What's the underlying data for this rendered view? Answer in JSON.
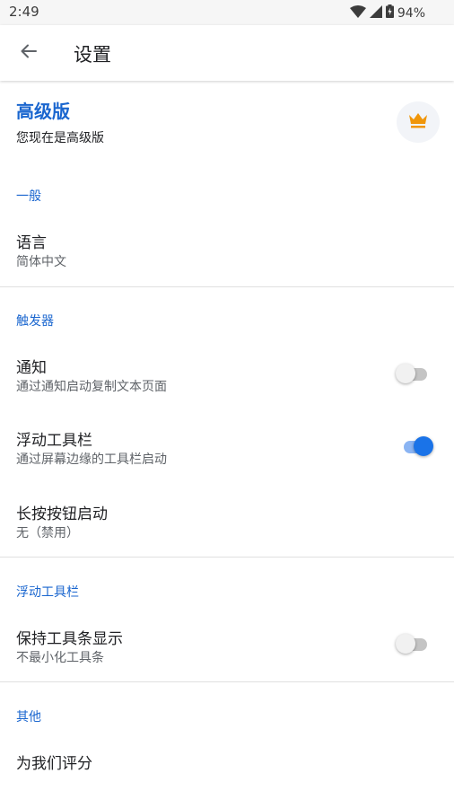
{
  "status_bar": {
    "time": "2:49",
    "battery": "94%",
    "icons": [
      "wifi-icon",
      "cell-signal-icon",
      "battery-icon"
    ]
  },
  "app_bar": {
    "title": "设置",
    "back_icon": "arrow-back-icon"
  },
  "premium": {
    "title": "高级版",
    "subtitle": "您现在是高级版",
    "icon": "crown-icon",
    "icon_color": "#f0960a"
  },
  "sections": {
    "general": {
      "header": "一般",
      "language": {
        "title": "语言",
        "subtitle": "简体中文"
      }
    },
    "triggers": {
      "header": "触发器",
      "notification": {
        "title": "通知",
        "subtitle": "通过通知启动复制文本页面",
        "enabled": false
      },
      "floating_toolbar": {
        "title": "浮动工具栏",
        "subtitle": "通过屏幕边缘的工具栏启动",
        "enabled": true
      },
      "long_press": {
        "title": "长按按钮启动",
        "subtitle": "无（禁用）"
      }
    },
    "floating": {
      "header": "浮动工具栏",
      "keep_visible": {
        "title": "保持工具条显示",
        "subtitle": "不最小化工具条",
        "enabled": false
      }
    },
    "other": {
      "header": "其他",
      "rate": {
        "title": "为我们评分"
      }
    }
  },
  "colors": {
    "accent": "#1a66cf",
    "switch_on": "#1a73e8",
    "switch_on_track": "#8ab4f3",
    "switch_off_track": "#c4c4c4"
  }
}
